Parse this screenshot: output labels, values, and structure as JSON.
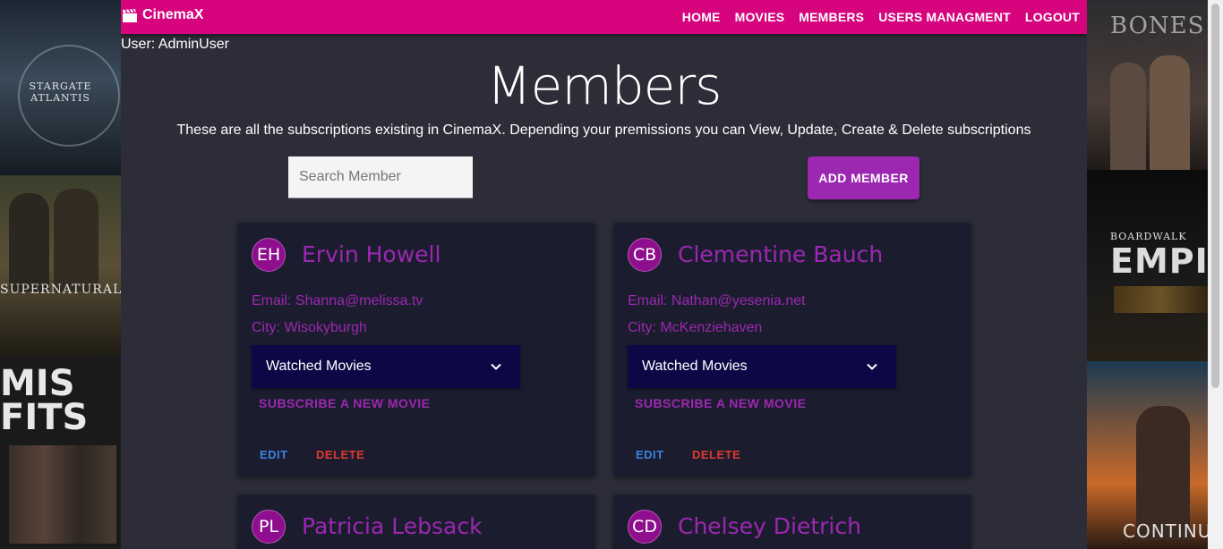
{
  "brand": {
    "name": "CinemaX",
    "icon": "clapperboard-icon"
  },
  "nav": {
    "links": [
      "HOME",
      "MOVIES",
      "MEMBERS",
      "USERS MANAGMENT",
      "LOGOUT"
    ]
  },
  "user_line": "User: AdminUser",
  "page": {
    "title": "Members",
    "subtitle": "These are all the subscriptions existing in CinemaX. Depending your premissions you can View, Update, Create & Delete subscriptions"
  },
  "search": {
    "placeholder": "Search Member",
    "value": ""
  },
  "add_button": "ADD MEMBER",
  "members": [
    {
      "initials": "EH",
      "name": "Ervin Howell",
      "email": "Email: Shanna@melissa.tv",
      "city": "City: Wisokyburgh",
      "watched": "Watched Movies",
      "subscribe": "SUBSCRIBE A NEW MOVIE",
      "edit": "EDIT",
      "delete": "DELETE"
    },
    {
      "initials": "CB",
      "name": "Clementine Bauch",
      "email": "Email: Nathan@yesenia.net",
      "city": "City: McKenziehaven",
      "watched": "Watched Movies",
      "subscribe": "SUBSCRIBE A NEW MOVIE",
      "edit": "EDIT",
      "delete": "DELETE"
    },
    {
      "initials": "PL",
      "name": "Patricia Lebsack"
    },
    {
      "initials": "CD",
      "name": "Chelsey Dietrich"
    }
  ],
  "colors": {
    "navbar": "#d6057d",
    "accent": "#9c27b0",
    "panel": "#2d2d3a",
    "card": "#1b1d2f",
    "select": "#0d0845",
    "edit": "#3a82e0",
    "delete": "#e0392f"
  }
}
